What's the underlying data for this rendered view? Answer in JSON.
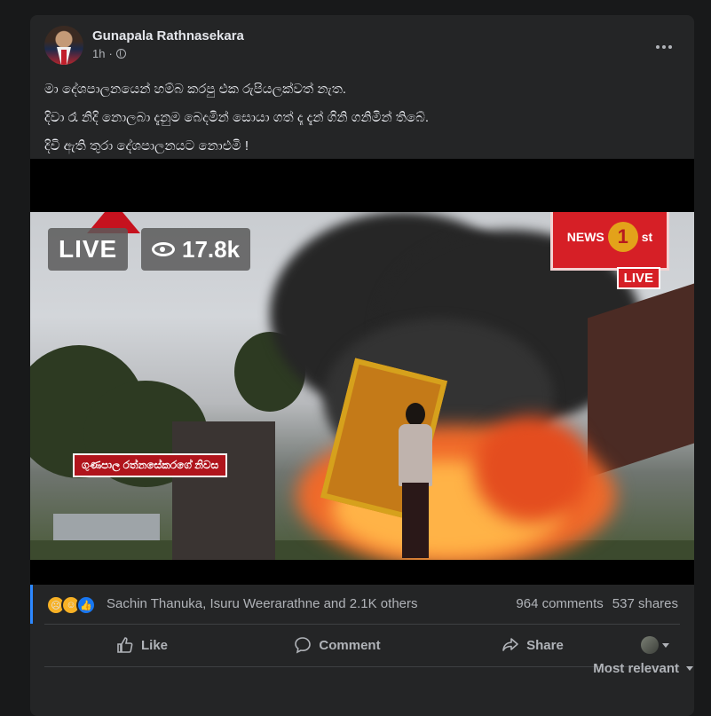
{
  "post": {
    "author": "Gunapala Rathnasekara",
    "time": "1h",
    "privacy_icon": "globe-icon",
    "body_lines": [
      "මා දේශපාලනයෙන් හම්බ කරපු එක රුපියලක්වත් නැත.",
      "දිවා රෑ නිදි නොලබා දැනුම බෙදමින් සොයා ගත් දෑ දැන් ගිනි ගනිමින් තිබේ.",
      "දිවි ඇති තුරා දේශපාලනයට නොඑමි !"
    ]
  },
  "video": {
    "live_label": "LIVE",
    "views": "17.8k",
    "channel_logo_text": "NEWS",
    "channel_logo_number": "1",
    "channel_logo_suffix": "st",
    "channel_live_label": "LIVE",
    "caption": "ගුණපාල රත්නසේකරගේ නිවස"
  },
  "reactions": {
    "icons": [
      "sad-icon",
      "haha-icon",
      "like-icon"
    ],
    "names": "Sachin Thanuka, Isuru Weerarathne and 2.1K others",
    "comments": "964 comments",
    "shares": "537 shares"
  },
  "actions": {
    "like": "Like",
    "comment": "Comment",
    "share": "Share"
  },
  "comments": {
    "sort_label": "Most relevant"
  },
  "colors": {
    "background": "#18191a",
    "card": "#242526",
    "accent": "#2d88ff",
    "secondary_text": "#b0b3b8"
  }
}
